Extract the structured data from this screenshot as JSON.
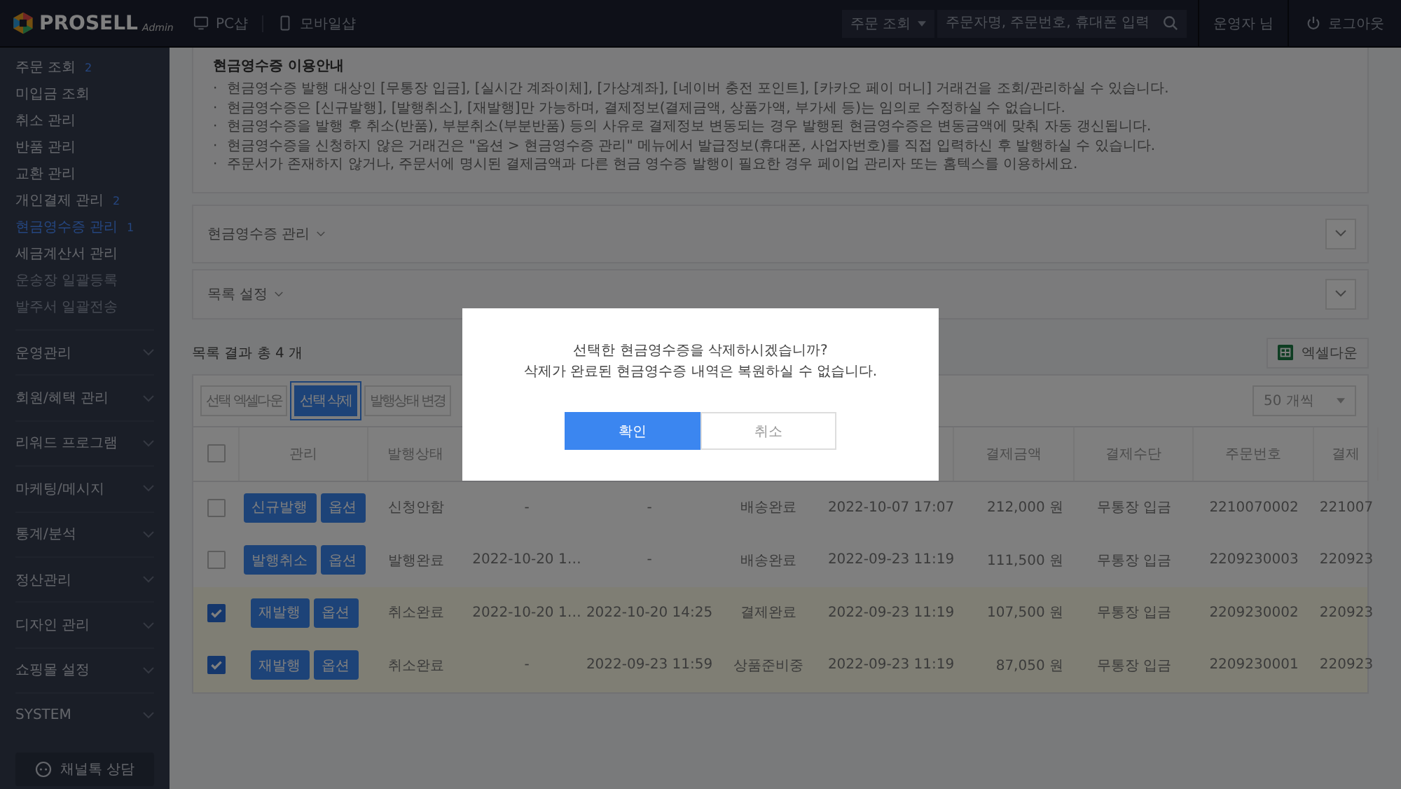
{
  "header": {
    "brand": "PROSELL",
    "brand_suffix": "Admin",
    "nav": [
      {
        "label": "PC샵",
        "kind": "pc"
      },
      {
        "label": "모바일샵",
        "kind": "mobile"
      }
    ],
    "search_scope": "주문 조회",
    "search": {
      "placeholder": "주문자명, 주문번호, 휴대폰 입력"
    },
    "user": "운영자 님",
    "logout": "로그아웃"
  },
  "sidebar": {
    "items": [
      {
        "label": "주문 조회",
        "badge": "2",
        "selected": false,
        "disabled": false
      },
      {
        "label": "미입금 조회",
        "selected": false,
        "disabled": false
      },
      {
        "label": "취소 관리",
        "selected": false,
        "disabled": false
      },
      {
        "label": "반품 관리",
        "selected": false,
        "disabled": false
      },
      {
        "label": "교환 관리",
        "selected": false,
        "disabled": false
      },
      {
        "label": "개인결제 관리",
        "badge": "2",
        "selected": false,
        "disabled": false
      },
      {
        "label": "현금영수증 관리",
        "badge": "1",
        "selected": true,
        "disabled": false
      },
      {
        "label": "세금계산서 관리",
        "selected": false,
        "disabled": false
      },
      {
        "label": "운송장 일괄등록",
        "selected": false,
        "disabled": true
      },
      {
        "label": "발주서 일괄전송",
        "selected": false,
        "disabled": true
      }
    ],
    "groups": [
      "운영관리",
      "회원/혜택 관리",
      "리워드 프로그램",
      "마케팅/메시지",
      "통계/분석",
      "정산관리",
      "디자인 관리",
      "쇼핑몰 설정",
      "SYSTEM"
    ],
    "chat_button": "채널톡 상담"
  },
  "notice": {
    "title": "현금영수증 이용안내",
    "bullet": "·",
    "lines": [
      "현금영수증 발행 대상인 [무통장 입금], [실시간 계좌이체], [가상계좌], [네이버 충전 포인트], [카카오 페이 머니] 거래건을 조회/관리하실 수 있습니다.",
      "현금영수증은 [신규발행], [발행취소], [재발행]만 가능하며, 결제정보(결제금액, 상품가액, 부가세 등)는 임의로 수정하실 수 없습니다.",
      "현금영수증을 발행 후 취소(반품), 부분취소(부분반품) 등의 사유로 결제정보 변동되는 경우 발행된 현금영수증은 변동금액에 맞춰 자동 갱신됩니다.",
      "현금영수증을 신청하지 않은 거래건은 \"옵션 > 현금영수증 관리\" 메뉴에서 발급정보(휴대폰, 사업자번호)를 직접 입력하신 후 발행하실 수 있습니다.",
      "주문서가 존재하지 않거나, 주문서에 명시된 결제금액과 다른 현금 영수증 발행이 필요한 경우 페이업 관리자 또는 홈텍스를 이용하세요."
    ]
  },
  "sections": [
    {
      "title": "현금영수증 관리"
    },
    {
      "title": "목록 설정"
    }
  ],
  "result": {
    "summary": "목록 결과 총 4 개",
    "excel_button": "엑셀다운"
  },
  "toolbar": {
    "buttons": [
      {
        "label": "선택 엑셀다운",
        "focused": false
      },
      {
        "label": "선택 삭제",
        "focused": true
      },
      {
        "label": "발행상태 변경",
        "focused": false
      }
    ],
    "page_size": "50 개씩"
  },
  "table": {
    "all_checked": false,
    "columns": [
      {},
      {
        "label": "관리"
      },
      {
        "label": "발행상태"
      },
      {},
      {},
      {},
      {},
      {
        "label": "결제금액"
      },
      {
        "label": "결제수단"
      },
      {
        "label": "주문번호"
      },
      {
        "label": "결제"
      }
    ],
    "rows": [
      {
        "checked": false,
        "cells": [
          {
            "kind": "check"
          },
          {
            "kind": "actions",
            "buttons": [
              "신규발행",
              "옵션"
            ]
          },
          {
            "text": "신청안함"
          },
          {
            "text": "-"
          },
          {
            "text": "-"
          },
          {
            "text": "배송완료"
          },
          {
            "text": "2022-10-07 17:07"
          },
          {
            "text": "212,000 원"
          },
          {
            "text": "무통장 입금"
          },
          {
            "text": "2210070002"
          },
          {
            "text": "221007"
          }
        ]
      },
      {
        "checked": false,
        "cells": [
          {
            "kind": "check"
          },
          {
            "kind": "actions",
            "buttons": [
              "발행취소",
              "옵션"
            ]
          },
          {
            "text": "발행완료"
          },
          {
            "text": "2022-10-20 1…"
          },
          {
            "text": "-"
          },
          {
            "text": "배송완료"
          },
          {
            "text": "2022-09-23 11:19"
          },
          {
            "text": "111,500 원"
          },
          {
            "text": "무통장 입금"
          },
          {
            "text": "2209230003"
          },
          {
            "text": "220923"
          }
        ]
      },
      {
        "checked": true,
        "cells": [
          {
            "kind": "check"
          },
          {
            "kind": "actions",
            "buttons": [
              "재발행",
              "옵션"
            ]
          },
          {
            "text": "취소완료"
          },
          {
            "text": "2022-10-20 1…"
          },
          {
            "text": "2022-10-20 14:25"
          },
          {
            "text": "결제완료"
          },
          {
            "text": "2022-09-23 11:19"
          },
          {
            "text": "107,500 원"
          },
          {
            "text": "무통장 입금"
          },
          {
            "text": "2209230002"
          },
          {
            "text": "220923"
          }
        ]
      },
      {
        "checked": true,
        "cells": [
          {
            "kind": "check"
          },
          {
            "kind": "actions",
            "buttons": [
              "재발행",
              "옵션"
            ]
          },
          {
            "text": "취소완료"
          },
          {
            "text": "-"
          },
          {
            "text": "2022-09-23 11:59"
          },
          {
            "text": "상품준비중"
          },
          {
            "text": "2022-09-23 11:19"
          },
          {
            "text": "87,050 원"
          },
          {
            "text": "무통장 입금"
          },
          {
            "text": "2209230001"
          },
          {
            "text": "220923"
          }
        ]
      }
    ]
  },
  "dialog": {
    "lines": [
      "선택한 현금영수증을 삭제하시겠습니까?",
      "삭제가 완료된 현금영수증 내역은 복원하실 수 없습니다."
    ],
    "confirm": "확인",
    "cancel": "취소"
  }
}
